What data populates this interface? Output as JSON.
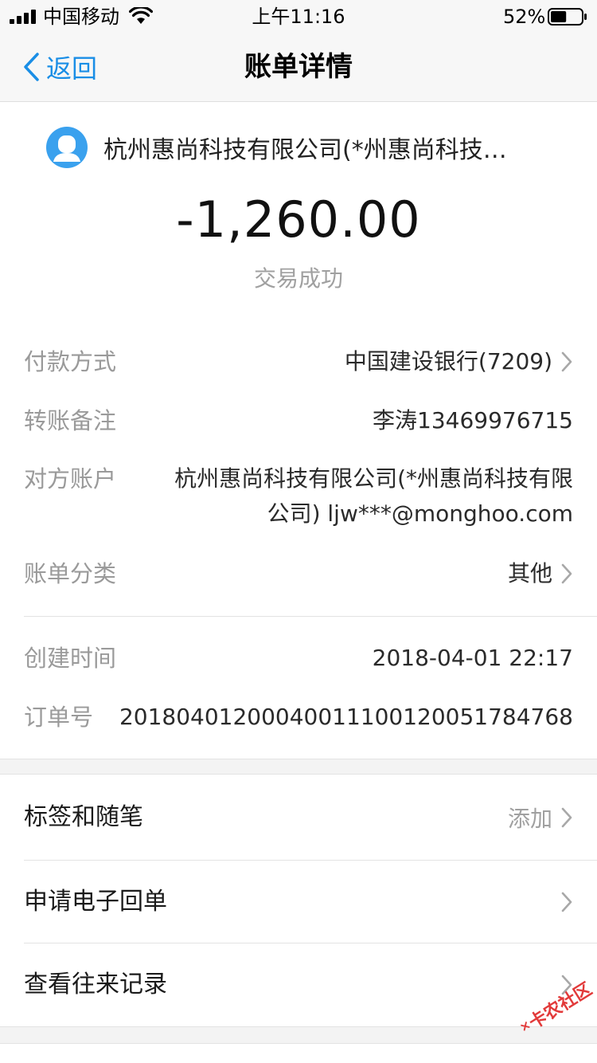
{
  "status_bar": {
    "carrier": "中国移动",
    "time": "上午11:16",
    "battery_percent": "52%",
    "battery_level": 0.52
  },
  "nav": {
    "back_label": "返回",
    "title": "账单详情"
  },
  "header": {
    "merchant_name": "杭州惠尚科技有限公司(*州惠尚科技…",
    "amount": "-1,260.00",
    "status": "交易成功"
  },
  "details": [
    {
      "label": "付款方式",
      "value": "中国建设银行(7209)"
    },
    {
      "label": "转账备注",
      "value": "李涛13469976715"
    },
    {
      "label": "对方账户",
      "value_line1": "杭州惠尚科技有限公司(*州惠尚科技有限",
      "value_line2": "公司) ljw***@monghoo.com"
    },
    {
      "label": "账单分类",
      "value": "其他"
    },
    {
      "label": "创建时间",
      "value": "2018-04-01 22:17"
    },
    {
      "label": "订单号",
      "value": "20180401200040011100120051784768"
    }
  ],
  "actions": [
    {
      "label": "标签和随笔",
      "hint": "添加"
    },
    {
      "label": "申请电子回单"
    },
    {
      "label": "查看往来记录"
    }
  ],
  "watermark": {
    "text": "卡农社区"
  },
  "colors": {
    "accent": "#1a8ee6",
    "avatar": "#3aa1ee",
    "muted": "#9a9a9a",
    "watermark": "#e23a3a"
  }
}
